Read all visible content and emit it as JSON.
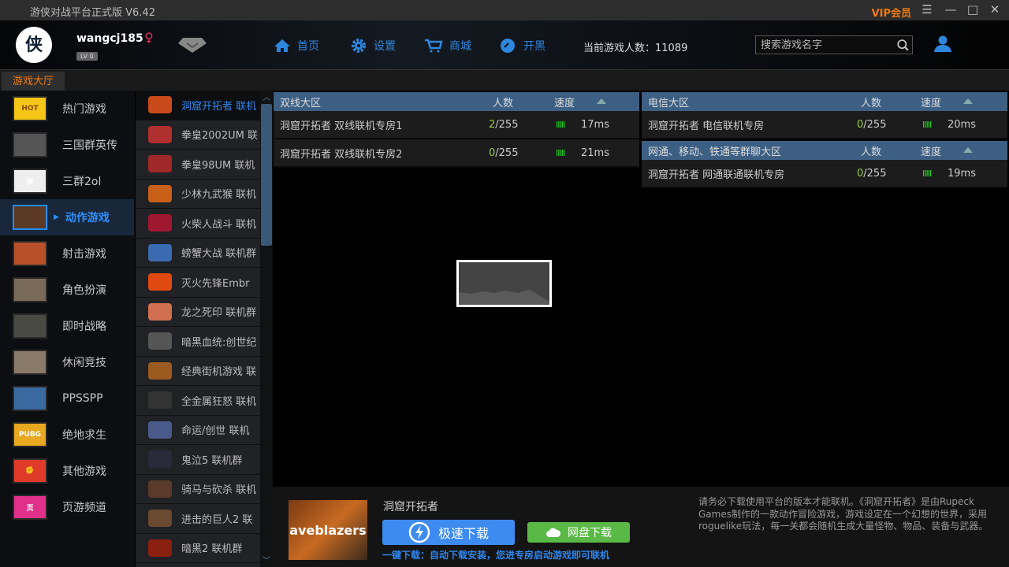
{
  "window": {
    "title": "游侠对战平台正式版 V6.42",
    "vip": "VIP会员"
  },
  "user": {
    "name": "wangcj185",
    "gender": "♀",
    "level": "LV 0",
    "avatar_text": "侠"
  },
  "nav": [
    {
      "label": "首页",
      "icon": "home-icon"
    },
    {
      "label": "设置",
      "icon": "gear-icon"
    },
    {
      "label": "商城",
      "icon": "cart-icon"
    },
    {
      "label": "开黑",
      "icon": "speed-icon"
    }
  ],
  "online": "当前游戏人数：11089",
  "search": {
    "placeholder": "搜索游戏名字"
  },
  "tab": "游戏大厅",
  "categories": [
    {
      "label": "热门游戏",
      "icon_text": "HOT",
      "color": "#f5c518"
    },
    {
      "label": "三国群英传",
      "icon_text": "",
      "color": "#555"
    },
    {
      "label": "三群2ol",
      "icon_text": "侠",
      "color": "#eee"
    },
    {
      "label": "动作游戏",
      "icon_text": "",
      "color": "#5a3a22"
    },
    {
      "label": "射击游戏",
      "icon_text": "",
      "color": "#b8502a"
    },
    {
      "label": "角色扮演",
      "icon_text": "",
      "color": "#7a6a5a"
    },
    {
      "label": "即时战略",
      "icon_text": "",
      "color": "#4a4a44"
    },
    {
      "label": "休闲竞技",
      "icon_text": "",
      "color": "#8a7a6a"
    },
    {
      "label": "PPSSPP",
      "icon_text": "",
      "color": "#3a6aa0"
    },
    {
      "label": "绝地求生",
      "icon_text": "PUBG",
      "color": "#e8a820"
    },
    {
      "label": "其他游戏",
      "icon_text": "✊",
      "color": "#e03a2a"
    },
    {
      "label": "页游频道",
      "icon_text": "页",
      "color": "#e0308a"
    }
  ],
  "games": [
    {
      "label": "洞窟开拓者 联机",
      "color": "#c84a1a"
    },
    {
      "label": "拳皇2002UM 联",
      "color": "#b03030"
    },
    {
      "label": "拳皇98UM 联机",
      "color": "#a02828"
    },
    {
      "label": "少林九武猴 联机",
      "color": "#c8601a"
    },
    {
      "label": "火柴人战斗 联机",
      "color": "#a01830"
    },
    {
      "label": "螃蟹大战 联机群",
      "color": "#3a6ab0"
    },
    {
      "label": "灭火先锋Embr",
      "color": "#e04a10"
    },
    {
      "label": "龙之死印 联机群",
      "color": "#d07050"
    },
    {
      "label": "暗黑血统:创世纪",
      "color": "#555"
    },
    {
      "label": "经典街机游戏 联",
      "color": "#9a5a20"
    },
    {
      "label": "全金属狂怒 联机",
      "color": "#333"
    },
    {
      "label": "命运/创世 联机",
      "color": "#4a5a8a"
    },
    {
      "label": "鬼泣5 联机群",
      "color": "#2a2a3a"
    },
    {
      "label": "骑马与砍杀 联机",
      "color": "#5a3a2a"
    },
    {
      "label": "进击的巨人2 联",
      "color": "#6a4a30"
    },
    {
      "label": "暗黑2 联机群",
      "color": "#8a2010"
    }
  ],
  "rooms": {
    "headers": {
      "players": "人数",
      "speed": "速度"
    },
    "shuangxian": {
      "title": "双线大区",
      "rows": [
        {
          "name": "洞窟开拓者 双线联机专房1",
          "cur": "2",
          "max": "/255",
          "ping": "17ms"
        },
        {
          "name": "洞窟开拓者 双线联机专房2",
          "cur": "0",
          "max": "/255",
          "ping": "21ms"
        }
      ]
    },
    "dianxin": {
      "title": "电信大区",
      "rows": [
        {
          "name": "洞窟开拓者 电信联机专房",
          "cur": "0",
          "max": "/255",
          "ping": "20ms"
        }
      ]
    },
    "wangtong": {
      "title": "网通、移动、铁通等群聊大区",
      "rows": [
        {
          "name": "洞窟开拓者 网通联通联机专房",
          "cur": "0",
          "max": "/255",
          "ping": "19ms"
        }
      ]
    },
    "signal": "IIIII"
  },
  "detail": {
    "cover_text": "aveblazers",
    "name": "洞窟开拓者",
    "fast_download": "极速下载",
    "cloud_download": "网盘下载",
    "hint": "一键下载：自动下载安装，您进专房启动游戏即可联机",
    "description": "请务必下载使用平台的版本才能联机。《洞窟开拓者》是由Rupeck Games制作的一款动作冒险游戏，游戏设定在一个幻想的世界，采用roguelike玩法，每一关都会随机生成大量怪物、物品、装备与武器。"
  }
}
